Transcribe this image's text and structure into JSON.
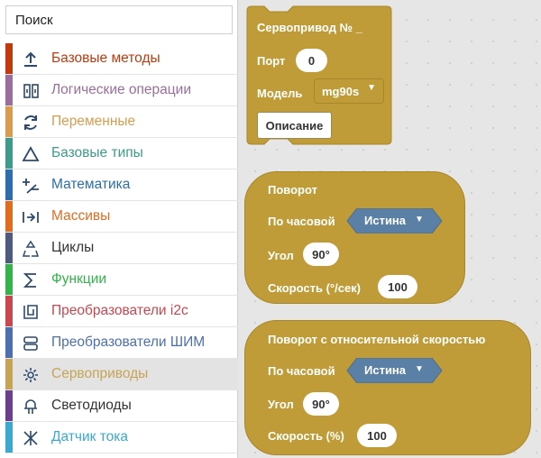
{
  "search": {
    "placeholder": "Поиск"
  },
  "categories": [
    {
      "label": "Базовые методы",
      "color": "#c03a0d",
      "icon": "upload-icon"
    },
    {
      "label": "Логические операции",
      "color": "#9a6e9c",
      "icon": "logic-icon"
    },
    {
      "label": "Переменные",
      "color": "#d99c4f",
      "icon": "variables-icon"
    },
    {
      "label": "Базовые типы",
      "color": "#3e9a8a",
      "icon": "triangle-icon"
    },
    {
      "label": "Математика",
      "color": "#2d6dad",
      "icon": "math-icon"
    },
    {
      "label": "Массивы",
      "color": "#e06c20",
      "icon": "arrays-icon"
    },
    {
      "label": "Циклы",
      "color": "#4e5a7e",
      "icon": "recycle-icon"
    },
    {
      "label": "Функции",
      "color": "#34b34a",
      "icon": "sigma-icon"
    },
    {
      "label": "Преобразователи i2c",
      "color": "#c9474f",
      "icon": "i2c-icon"
    },
    {
      "label": "Преобразователи ШИМ",
      "color": "#4c6fb0",
      "icon": "pwm-icon"
    },
    {
      "label": "Сервоприводы",
      "color": "#c6a455",
      "icon": "gear-icon",
      "selected": true
    },
    {
      "label": "Светодиоды",
      "color": "#6b3f8c",
      "icon": "led-icon"
    },
    {
      "label": "Датчик тока",
      "color": "#3ba9cf",
      "icon": "current-sensor-icon"
    }
  ],
  "blocks": {
    "servo": {
      "title": "Сервопривод № _",
      "port_label": "Порт",
      "port_value": "0",
      "model_label": "Модель",
      "model_value": "mg90s",
      "description_button": "Описание"
    },
    "rotate": {
      "title": "Поворот",
      "clockwise_label": "По часовой",
      "clockwise_value": "Истина",
      "angle_label": "Угол",
      "angle_value": "90°",
      "speed_label": "Скорость (°/сек)",
      "speed_value": "100"
    },
    "rotate_rel": {
      "title": "Поворот с относительной скоростью",
      "clockwise_label": "По часовой",
      "clockwise_value": "Истина",
      "angle_label": "Угол",
      "angle_value": "90°",
      "speed_label": "Скорость (%)",
      "speed_value": "100"
    }
  },
  "colors": {
    "block": "#bf9c37",
    "boolean_block": "#5b80a5",
    "selected_row": "#e3e3e3"
  }
}
